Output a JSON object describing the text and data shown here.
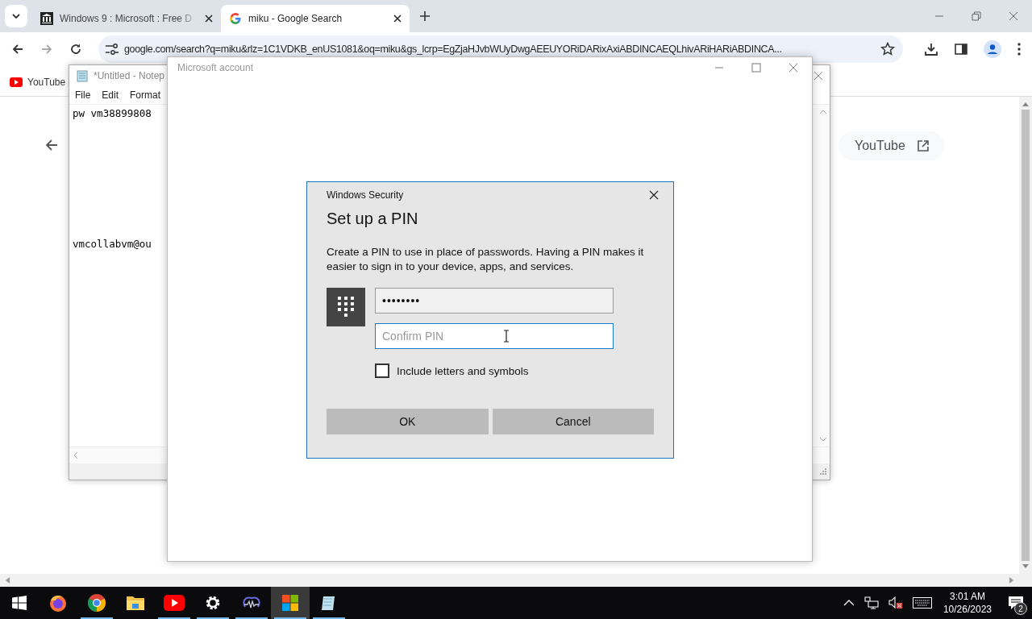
{
  "browser": {
    "tabs": [
      {
        "title": "Windows 9 : Microsoft : Free D",
        "kind": "archive",
        "selected": false
      },
      {
        "title": "miku - Google Search",
        "kind": "google",
        "selected": true
      }
    ],
    "address": "google.com/search?q=miku&rlz=1C1VDKB_enUS1081&oq=miku&gs_lcrp=EgZjaHJvbWUyDwgAEEUYORiDARixAxiABDINCAEQLhivARiHARiABDINCA...",
    "bookmarks": [
      {
        "label": "YouTube"
      }
    ],
    "page": {
      "chip": "YouTube"
    }
  },
  "notepad": {
    "title": "*Untitled - Notep",
    "menu": [
      "File",
      "Edit",
      "Format"
    ],
    "lines": [
      "pw vm38899808",
      "vmcollabvm@ou"
    ]
  },
  "account_window": {
    "title": "Microsoft account"
  },
  "dialog": {
    "app": "Windows Security",
    "heading": "Set up a PIN",
    "description": "Create a PIN to use in place of passwords. Having a PIN makes it easier to sign in to your device, apps, and services.",
    "pin": {
      "value": "••••••••"
    },
    "confirm": {
      "placeholder": "Confirm PIN"
    },
    "include_letters": {
      "label": "Include letters and symbols",
      "checked": false
    },
    "buttons": [
      "OK",
      "Cancel"
    ]
  },
  "taskbar": {
    "apps": [
      {
        "kind": "firefox",
        "running": false,
        "selected": false
      },
      {
        "kind": "chrome",
        "running": true,
        "selected": false
      },
      {
        "kind": "explorer",
        "running": false,
        "selected": false
      },
      {
        "kind": "youtube",
        "running": true,
        "selected": false
      },
      {
        "kind": "settings",
        "running": true,
        "selected": false
      },
      {
        "kind": "waveform",
        "running": true,
        "selected": false
      },
      {
        "kind": "store",
        "running": true,
        "selected": true
      },
      {
        "kind": "notepad",
        "running": true,
        "selected": false
      }
    ],
    "time": "3:01 AM",
    "date": "10/26/2023",
    "notifications": "2"
  }
}
